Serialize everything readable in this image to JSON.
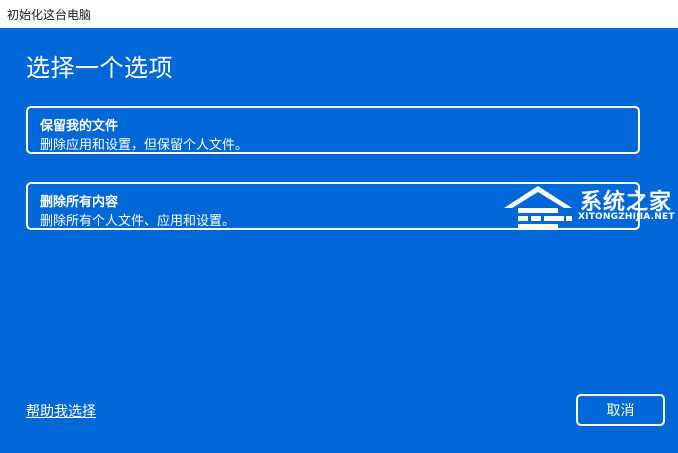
{
  "window": {
    "title": "初始化这台电脑"
  },
  "main": {
    "heading": "选择一个选项",
    "options": [
      {
        "title": "保留我的文件",
        "description": "删除应用和设置，但保留个人文件。"
      },
      {
        "title": "删除所有内容",
        "description": "删除所有个人文件、应用和设置。"
      }
    ]
  },
  "footer": {
    "help_link": "帮助我选择",
    "cancel_label": "取消"
  },
  "watermark": {
    "name": "系统之家",
    "site": "XITONGZHIJIA.NET"
  },
  "colors": {
    "background": "#0067d6",
    "foreground": "#ffffff",
    "titlebar": "#ffffff"
  }
}
